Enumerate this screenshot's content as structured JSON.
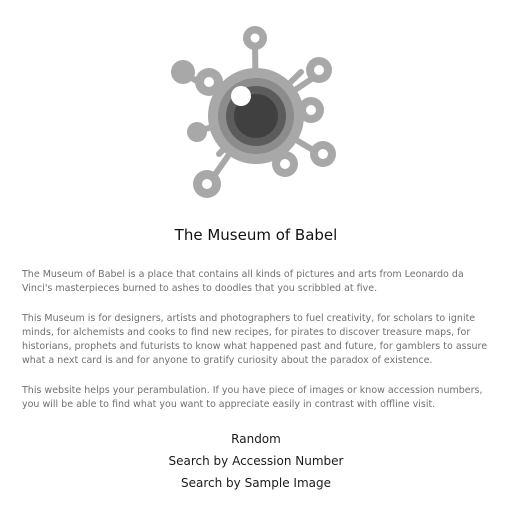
{
  "logo": {
    "icon": "eye-virus-icon",
    "colors": {
      "outer": "#a8a8a8",
      "ring": "#8c8c8c",
      "iris": "#5c5c5c",
      "pupil": "#404040",
      "highlight": "#ffffff"
    }
  },
  "page": {
    "title": "The Museum of Babel"
  },
  "description": {
    "paragraph1": "The Museum of Babel is a place that contains all kinds of pictures and arts from Leonardo da Vinci's masterpieces burned to ashes to doodles that you scribbled at five.",
    "paragraph2": "This Museum is for designers, artists and photographers to fuel creativity, for scholars to ignite minds, for alchemists and cooks to find new recipes, for pirates to discover treasure maps, for historians, prophets and futurists to know what happened past and future, for gamblers to assure what a next card is and for anyone to gratify curiosity about the paradox of existence.",
    "paragraph3": "This website helps your perambulation. If you have piece of images or know accession numbers, you will be able to find what you want to appreciate easily in contrast with offline visit."
  },
  "nav": {
    "random": "Random",
    "search_accession": "Search by Accession Number",
    "search_image": "Search by Sample Image"
  }
}
